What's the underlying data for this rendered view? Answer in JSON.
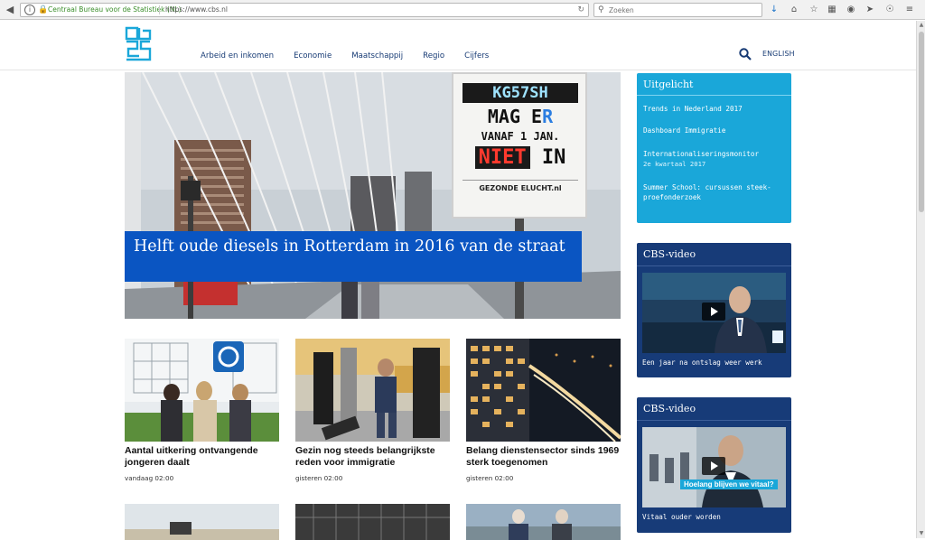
{
  "browser": {
    "site_identity": "Centraal Bureau voor de Statistiek (NL)",
    "url": "https://www.cbs.nl",
    "search_placeholder": "Zoeken"
  },
  "header": {
    "nav": [
      "Arbeid en inkomen",
      "Economie",
      "Maatschappij",
      "Regio",
      "Cijfers"
    ],
    "language_link": "ENGLISH"
  },
  "hero": {
    "headline": "Helft oude diesels in Rotterdam in 2016 van de straat",
    "sign": {
      "line1": "KG57SH",
      "line2a": "MAG E",
      "line2b": "R",
      "line3": "VANAF 1 JAN.",
      "line4a": "NIET",
      "line4b": "IN",
      "footer": "GEZONDE   ELUCHT.nl"
    }
  },
  "news": [
    {
      "title": "Aantal uitkering ontvangende jongeren daalt",
      "date": "vandaag 02:00"
    },
    {
      "title": "Gezin nog steeds belangrijkste reden voor immigratie",
      "date": "gisteren 02:00"
    },
    {
      "title": "Belang dienstensector sinds 1969 sterk toegenomen",
      "date": "gisteren 02:00"
    }
  ],
  "uitgelicht": {
    "heading": "Uitgelicht",
    "items": [
      {
        "label": "Trends in Nederland 2017",
        "sub": ""
      },
      {
        "label": "Dashboard Immigratie",
        "sub": ""
      },
      {
        "label": "Internationaliseringsmonitor",
        "sub": "2e kwartaal 2017"
      },
      {
        "label": "Summer School: cursussen steek-proefonderzoek",
        "sub": ""
      }
    ]
  },
  "videos": [
    {
      "heading": "CBS-video",
      "caption": "Een jaar na ontslag weer werk"
    },
    {
      "heading": "CBS-video",
      "caption": "Vitaal ouder worden",
      "overlay": "Hoelang blijven we vitaal?"
    }
  ],
  "colors": {
    "nav_text": "#163a74",
    "hero_caption_bg": "#0a55c2",
    "uitgelicht_bg": "#1aa7d9",
    "video_bg": "#173b78",
    "logo": "#1aa7d9"
  },
  "icons": [
    "info-icon",
    "lock-icon",
    "reload-icon",
    "search-icon",
    "download-icon",
    "home-icon",
    "star-icon",
    "clipboard-icon",
    "pocket-icon",
    "send-icon",
    "globe-icon",
    "play-icon"
  ]
}
